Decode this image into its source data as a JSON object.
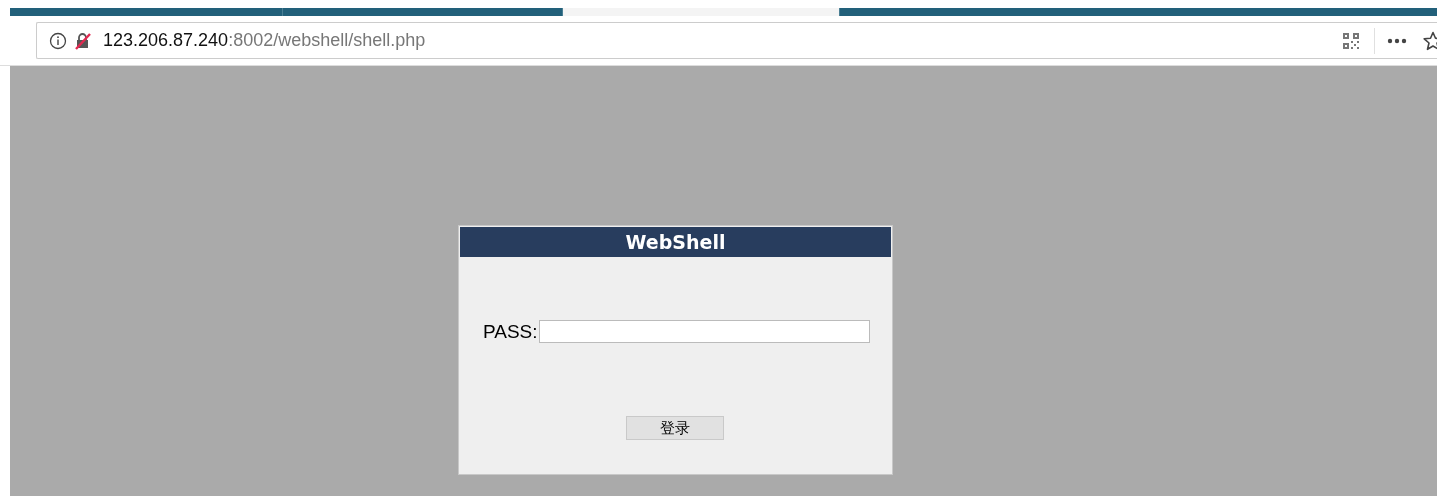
{
  "browser": {
    "tabs": [
      {
        "selected": false
      },
      {
        "selected": false
      },
      {
        "selected": true
      },
      {
        "selected": false
      }
    ],
    "address": {
      "host": "123.206.87.240",
      "rest": ":8002/webshell/shell.php"
    }
  },
  "dialog": {
    "title": "WebShell",
    "fields": [
      {
        "label": "PASS:"
      }
    ],
    "buttons": [
      "登录"
    ]
  }
}
